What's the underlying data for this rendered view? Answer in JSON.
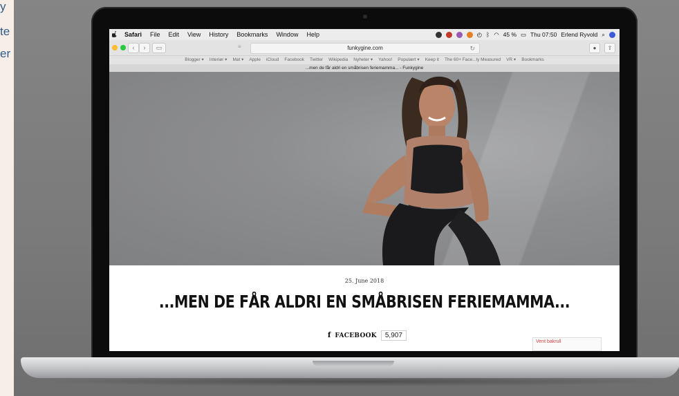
{
  "page": {
    "side_fragments": [
      "y",
      "te",
      "er"
    ]
  },
  "menubar": {
    "apple": "",
    "items": [
      "Safari",
      "File",
      "Edit",
      "View",
      "History",
      "Bookmarks",
      "Window",
      "Help"
    ],
    "battery": "45 %",
    "clock": "Thu 07:50",
    "user": "Erlend Ryvold"
  },
  "toolbar": {
    "url": "funkygine.com"
  },
  "bookmarks": [
    "Blogger ▾",
    "Interiør ▾",
    "Mat ▾",
    "Apple",
    "iCloud",
    "Facebook",
    "Twitter",
    "Wikipedia",
    "Nyheter ▾",
    "Yahoo!",
    "Populært ▾",
    "Keep it",
    "The 60+ Face...ly Measured",
    "VR ▾",
    "Bookmarks"
  ],
  "tab": {
    "title": "...men de får aldri en småbrisen feriemamma... - Funkygine"
  },
  "article": {
    "date": "25. June 2018",
    "headline": "...MEN DE FÅR ALDRI EN SMÅBRISEN FERIEMAMMA...",
    "facebook_label": "FACEBOOK",
    "facebook_count": "5,907"
  },
  "widget": {
    "label": "Vent bakrull"
  },
  "colors": {
    "close": "#ff5f57",
    "minimize": "#febc2e",
    "zoom": "#28c840",
    "headline": "#111111"
  }
}
